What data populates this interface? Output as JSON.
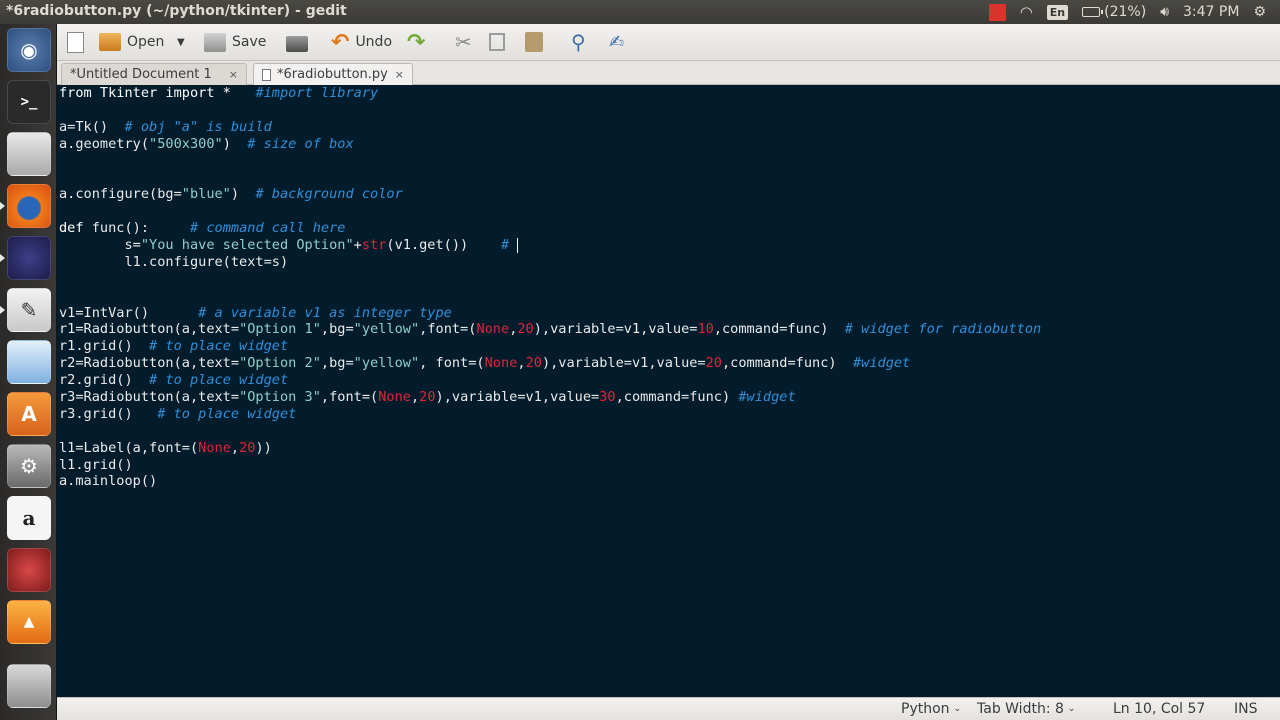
{
  "window": {
    "title": "*6radiobutton.py (~/python/tkinter) - gedit"
  },
  "tray": {
    "lang": "En",
    "battery": "(21%)",
    "time": "3:47 PM"
  },
  "toolbar": {
    "open_label": "Open",
    "save_label": "Save",
    "undo_label": "Undo"
  },
  "tabs": [
    {
      "label": "*Untitled Document 1",
      "close": "×"
    },
    {
      "label": "*6radiobutton.py",
      "close": "×"
    }
  ],
  "status": {
    "language": "Python",
    "tab_width": "Tab Width: 8",
    "position": "Ln 10, Col 57",
    "mode": "INS"
  },
  "code_lines": [
    [
      [
        "kw",
        "from Tkinter import * "
      ],
      [
        "plain",
        "  "
      ],
      [
        "cm",
        "#import library"
      ]
    ],
    [],
    [
      [
        "plain",
        "a=Tk()  "
      ],
      [
        "cm",
        "# obj \"a\" is build"
      ]
    ],
    [
      [
        "plain",
        "a.geometry("
      ],
      [
        "str",
        "\"500x300\""
      ],
      [
        "plain",
        ")  "
      ],
      [
        "cm",
        "# size of box"
      ]
    ],
    [],
    [],
    [
      [
        "plain",
        "a.configure(bg="
      ],
      [
        "str",
        "\"blue\""
      ],
      [
        "plain",
        ")  "
      ],
      [
        "cm",
        "# background color"
      ]
    ],
    [],
    [
      [
        "kw",
        "def"
      ],
      [
        "plain",
        " func():     "
      ],
      [
        "cm",
        "# command call here"
      ]
    ],
    [
      [
        "plain",
        "        s="
      ],
      [
        "str",
        "\"You have selected Option\""
      ],
      [
        "plain",
        "+"
      ],
      [
        "builtin",
        "str"
      ],
      [
        "plain",
        "(v1.get())    "
      ],
      [
        "cm",
        "# "
      ],
      [
        "cursor",
        ""
      ]
    ],
    [
      [
        "plain",
        "        l1.configure(text=s)"
      ]
    ],
    [],
    [],
    [
      [
        "plain",
        "v1=IntVar()      "
      ],
      [
        "cm",
        "# a variable v1 as integer type"
      ]
    ],
    [
      [
        "plain",
        "r1=Radiobutton(a,text="
      ],
      [
        "str",
        "\"Option 1\""
      ],
      [
        "plain",
        ",bg="
      ],
      [
        "str",
        "\"yellow\""
      ],
      [
        "plain",
        ",font=("
      ],
      [
        "none",
        "None"
      ],
      [
        "plain",
        ","
      ],
      [
        "num",
        "20"
      ],
      [
        "plain",
        "),variable=v1,value="
      ],
      [
        "num",
        "10"
      ],
      [
        "plain",
        ",command=func)  "
      ],
      [
        "cm",
        "# widget for radiobutton"
      ]
    ],
    [
      [
        "plain",
        "r1.grid()  "
      ],
      [
        "cm",
        "# to place widget"
      ]
    ],
    [
      [
        "plain",
        "r2=Radiobutton(a,text="
      ],
      [
        "str",
        "\"Option 2\""
      ],
      [
        "plain",
        ",bg="
      ],
      [
        "str",
        "\"yellow\""
      ],
      [
        "plain",
        ", font=("
      ],
      [
        "none",
        "None"
      ],
      [
        "plain",
        ","
      ],
      [
        "num",
        "20"
      ],
      [
        "plain",
        "),variable=v1,value="
      ],
      [
        "num",
        "20"
      ],
      [
        "plain",
        ",command=func)  "
      ],
      [
        "cm",
        "#widget"
      ]
    ],
    [
      [
        "plain",
        "r2.grid()  "
      ],
      [
        "cm",
        "# to place widget"
      ]
    ],
    [
      [
        "plain",
        "r3=Radiobutton(a,text="
      ],
      [
        "str",
        "\"Option 3\""
      ],
      [
        "plain",
        ",font=("
      ],
      [
        "none",
        "None"
      ],
      [
        "plain",
        ","
      ],
      [
        "num",
        "20"
      ],
      [
        "plain",
        "),variable=v1,value="
      ],
      [
        "num",
        "30"
      ],
      [
        "plain",
        ",command=func) "
      ],
      [
        "cm",
        "#widget"
      ]
    ],
    [
      [
        "plain",
        "r3.grid()   "
      ],
      [
        "cm",
        "# to place widget"
      ]
    ],
    [],
    [
      [
        "plain",
        "l1=Label(a,font=("
      ],
      [
        "none",
        "None"
      ],
      [
        "plain",
        ","
      ],
      [
        "num",
        "20"
      ],
      [
        "plain",
        "))"
      ]
    ],
    [
      [
        "plain",
        "l1.grid()"
      ]
    ],
    [
      [
        "plain",
        "a.mainloop()"
      ]
    ]
  ]
}
